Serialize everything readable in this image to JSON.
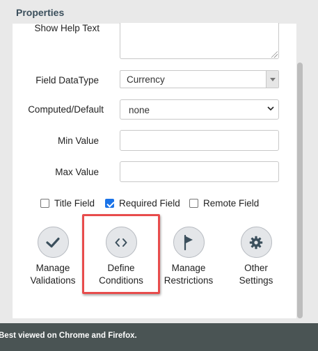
{
  "panel": {
    "title": "Properties"
  },
  "form": {
    "help_text_label": "Show Help Text",
    "help_text_value": "",
    "datatype_label": "Field DataType",
    "datatype_value": "Currency",
    "computed_label": "Computed/Default",
    "computed_value": "none",
    "min_label": "Min Value",
    "min_value": "",
    "max_label": "Max Value",
    "max_value": ""
  },
  "checkboxes": [
    {
      "label": "Title Field",
      "checked": false
    },
    {
      "label": "Required Field",
      "checked": true
    },
    {
      "label": "Remote Field",
      "checked": false
    }
  ],
  "actions": [
    {
      "line1": "Manage",
      "line2": "Validations",
      "icon": "check-icon"
    },
    {
      "line1": "Define",
      "line2": "Conditions",
      "icon": "code-brackets-icon"
    },
    {
      "line1": "Manage",
      "line2": "Restrictions",
      "icon": "flag-icon"
    },
    {
      "line1": "Other",
      "line2": "Settings",
      "icon": "gear-icon"
    }
  ],
  "colors": {
    "highlight": "#e84c4c",
    "accent": "#1a73e8",
    "footer_bg": "#4a5454"
  },
  "footer": {
    "text": "Best viewed on Chrome and Firefox."
  }
}
